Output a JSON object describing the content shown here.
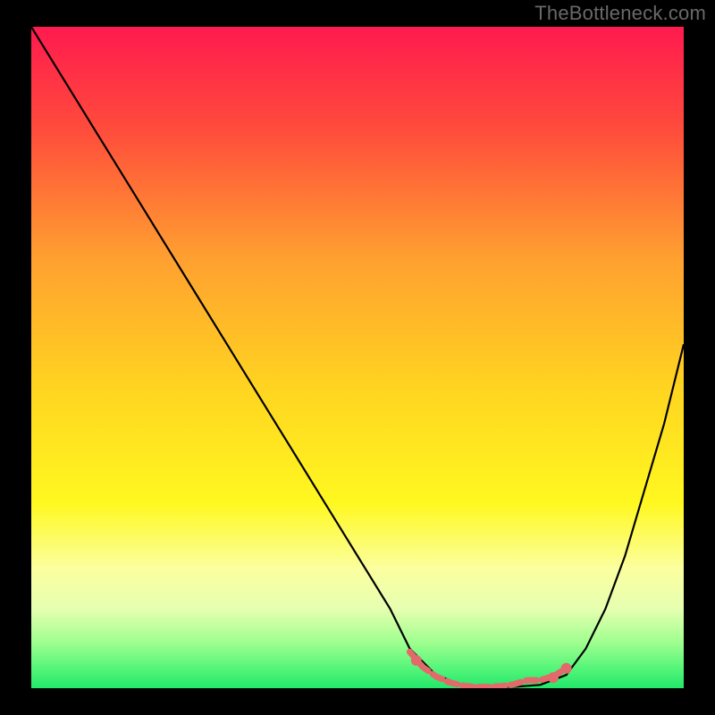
{
  "watermark": "TheBottleneck.com",
  "chart_data": {
    "type": "line",
    "title": "",
    "xlabel": "",
    "ylabel": "",
    "xlim": [
      0,
      100
    ],
    "ylim": [
      0,
      100
    ],
    "grid": false,
    "gradient_stops": [
      {
        "offset": 0.0,
        "color": "#ff1a4f"
      },
      {
        "offset": 0.15,
        "color": "#ff4a3c"
      },
      {
        "offset": 0.35,
        "color": "#ffa030"
      },
      {
        "offset": 0.55,
        "color": "#ffd520"
      },
      {
        "offset": 0.72,
        "color": "#fff820"
      },
      {
        "offset": 0.82,
        "color": "#fbffa0"
      },
      {
        "offset": 0.88,
        "color": "#e6ffb0"
      },
      {
        "offset": 0.93,
        "color": "#a0ff90"
      },
      {
        "offset": 0.97,
        "color": "#55f57a"
      },
      {
        "offset": 1.0,
        "color": "#22e86a"
      }
    ],
    "series": [
      {
        "name": "curve",
        "color": "#000000",
        "x": [
          0,
          5,
          10,
          15,
          20,
          25,
          30,
          35,
          40,
          45,
          50,
          55,
          58,
          62,
          66,
          70,
          74,
          78,
          82,
          85,
          88,
          91,
          94,
          97,
          100
        ],
        "y": [
          100,
          92,
          84,
          76,
          68,
          60,
          52,
          44,
          36,
          28,
          20,
          12,
          6,
          2,
          0.5,
          0.2,
          0.2,
          0.5,
          2,
          6,
          12,
          20,
          30,
          40,
          52
        ]
      },
      {
        "name": "highlight",
        "color": "#e26a6a",
        "x": [
          58,
          60,
          62,
          64,
          66,
          68,
          70,
          72,
          74,
          76,
          78,
          80,
          82
        ],
        "y": [
          5.5,
          3.2,
          1.8,
          0.9,
          0.4,
          0.2,
          0.2,
          0.3,
          0.6,
          1.2,
          1.2,
          1.8,
          3.0
        ]
      }
    ],
    "highlight_markers": {
      "color": "#e26a6a",
      "points": [
        {
          "x": 59,
          "y": 4.2
        },
        {
          "x": 80,
          "y": 1.6
        },
        {
          "x": 82,
          "y": 3.0
        }
      ]
    }
  }
}
